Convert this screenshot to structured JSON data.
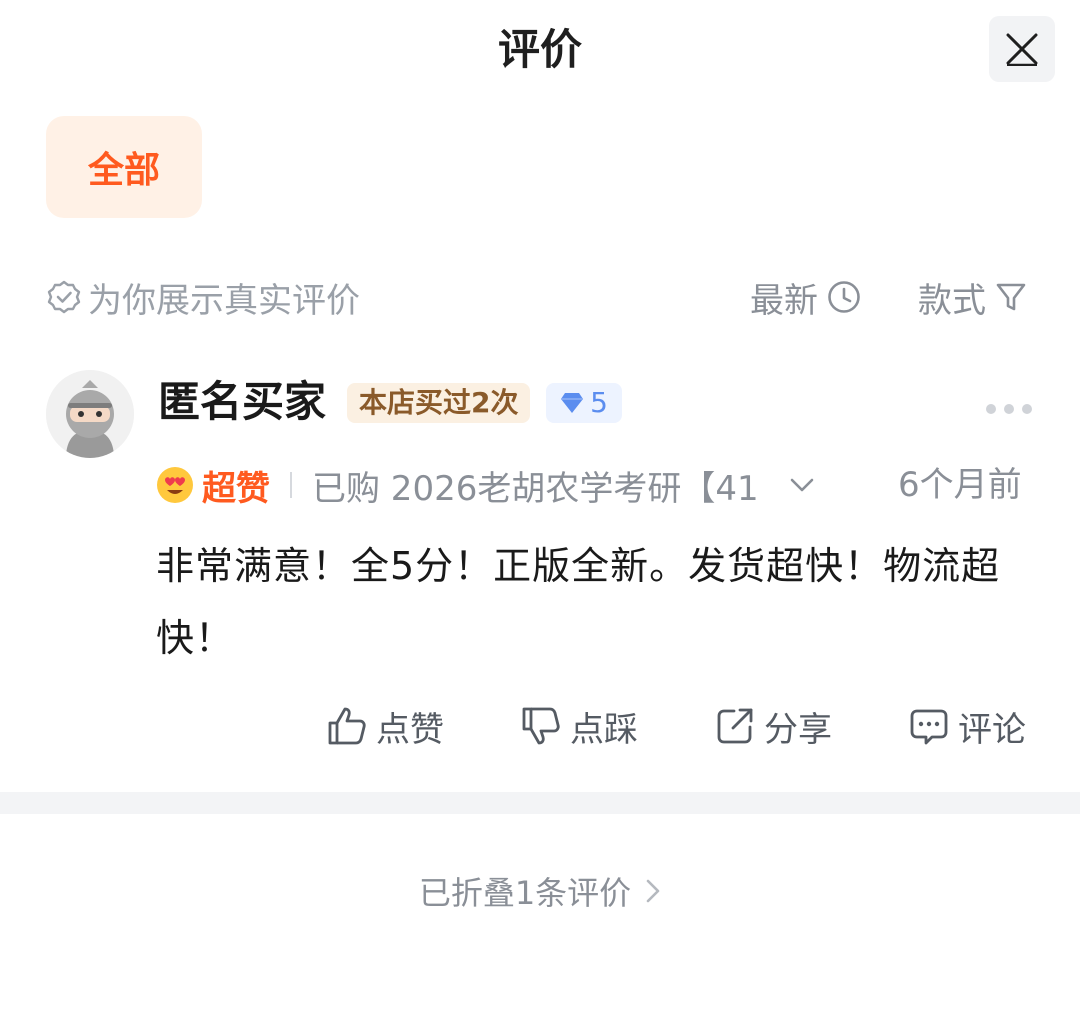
{
  "header": {
    "title": "评价"
  },
  "filters": {
    "all_label": "全部"
  },
  "notice": {
    "text": "为你展示真实评价"
  },
  "sort": {
    "newest_label": "最新",
    "style_label": "款式"
  },
  "review": {
    "username": "匿名买家",
    "purchase_badge": "本店买过2次",
    "level": "5",
    "rating_label": "超赞",
    "purchased_item": "已购 2026老胡农学考研【41",
    "time_ago": "6个月前",
    "content": "非常满意！全5分！正版全新。发货超快！物流超快！",
    "actions": {
      "like": "点赞",
      "dislike": "点踩",
      "share": "分享",
      "comment": "评论"
    }
  },
  "folded": {
    "text": "已折叠1条评价"
  },
  "colors": {
    "accent": "#ff5a1f",
    "chip_bg": "#fff1e6",
    "level_blue": "#5b8def"
  }
}
